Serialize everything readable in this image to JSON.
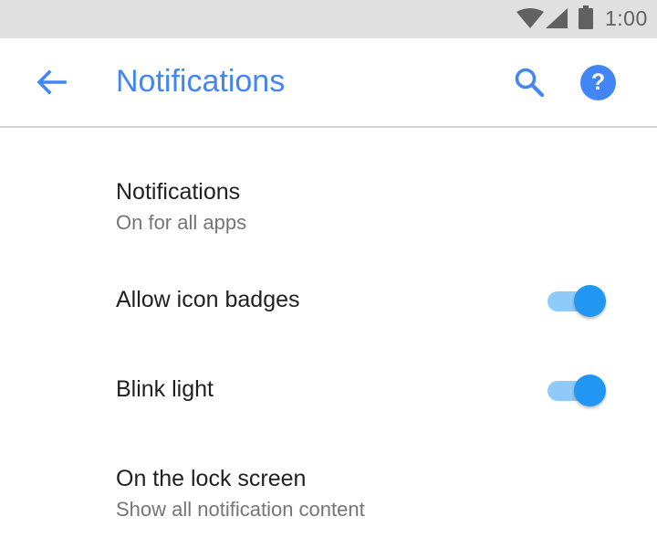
{
  "status_bar": {
    "time": "1:00",
    "icons": [
      "wifi-icon",
      "cellular-signal-icon",
      "battery-icon"
    ]
  },
  "app_bar": {
    "title": "Notifications",
    "back_icon": "arrow-back-icon",
    "search_icon": "search-icon",
    "help_icon": "help-icon",
    "help_glyph": "?",
    "accent_color": "#4285f4"
  },
  "settings": {
    "notifications": {
      "title": "Notifications",
      "summary": "On for all apps"
    },
    "icon_badges": {
      "title": "Allow icon badges",
      "enabled": true
    },
    "blink_light": {
      "title": "Blink light",
      "enabled": true
    },
    "lock_screen": {
      "title": "On the lock screen",
      "summary": "Show all notification content"
    }
  },
  "colors": {
    "toggle_thumb": "#2196f3",
    "toggle_track": "#90caf9",
    "status_bar_bg": "#e0e0e0"
  }
}
